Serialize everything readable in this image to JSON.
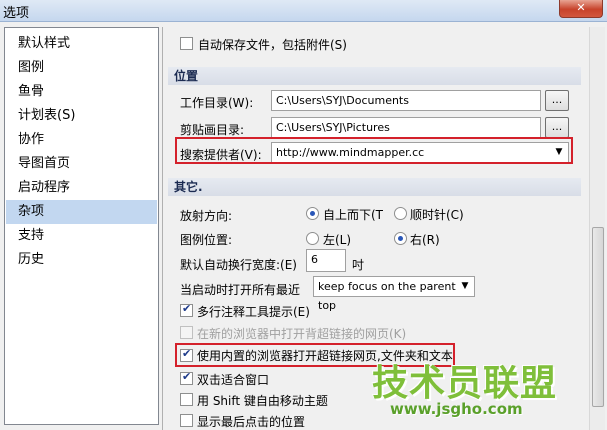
{
  "window": {
    "title": "选项",
    "close_glyph": "✕"
  },
  "sidebar": {
    "items": [
      {
        "label": "默认样式",
        "selected": false
      },
      {
        "label": "图例",
        "selected": false
      },
      {
        "label": "鱼骨",
        "selected": false
      },
      {
        "label": "计划表(S)",
        "selected": false
      },
      {
        "label": "协作",
        "selected": false
      },
      {
        "label": "导图首页",
        "selected": false
      },
      {
        "label": "启动程序",
        "selected": false
      },
      {
        "label": "杂项",
        "selected": true
      },
      {
        "label": "支持",
        "selected": false
      },
      {
        "label": "历史",
        "selected": false
      }
    ]
  },
  "content": {
    "autosave": {
      "label": "自动保存文件，包括附件(S)",
      "checked": false
    },
    "location_section": {
      "title": "位置"
    },
    "work_dir": {
      "label": "工作目录(W):",
      "value": "C:\\Users\\SYJ\\Documents",
      "browse": "..."
    },
    "clip_dir": {
      "label": "剪贴画目录:",
      "value": "C:\\Users\\SYJ\\Pictures",
      "browse": "..."
    },
    "search_provider": {
      "label": "搜索提供者(V):",
      "value": "http://www.mindmapper.cc"
    },
    "other_section": {
      "title": "其它."
    },
    "radial": {
      "label": "放射方向:",
      "option1": "自上而下(T",
      "option2": "顺时针(C)",
      "selected": "option1"
    },
    "legend_pos": {
      "label": "图例位置:",
      "option1": "左(L)",
      "option2": "右(R)",
      "selected": "option2"
    },
    "wrap_width": {
      "label": "默认自动换行宽度:(E)",
      "value": "6",
      "unit": "吋"
    },
    "auto_open": {
      "label": "当启动时打开所有最近",
      "value": "keep focus on the parent top"
    },
    "multiline_tips": {
      "label": "多行注释工具提示(E)",
      "checked": true
    },
    "open_new_browser": {
      "label": "在新的浏览器中打开背超链接的网页(K)",
      "checked": false,
      "disabled": true
    },
    "builtin_browser": {
      "label": "使用内置的浏览器打开超链接网页,文件夹和文本",
      "checked": true
    },
    "dblclick_fit": {
      "label": "双击适合窗口",
      "checked": true
    },
    "shift_move": {
      "label": "用 Shift 键自由移动主题",
      "checked": false
    },
    "show_last_pos": {
      "label": "显示最后点击的位置",
      "checked": false
    }
  },
  "watermark": {
    "main": "技术员联盟",
    "sub": "www.jsgho.com"
  },
  "colors": {
    "highlight_red": "#d4212b",
    "selection_blue": "#c2d7f0",
    "watermark_green": "#7fbf3a"
  }
}
